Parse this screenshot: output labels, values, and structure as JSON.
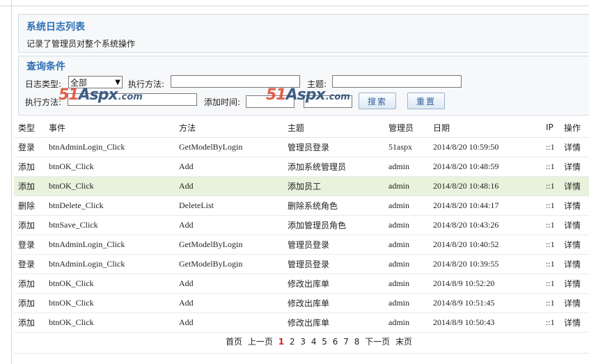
{
  "header": {
    "title": "系统日志列表",
    "description": "记录了管理员对整个系统操作"
  },
  "query": {
    "title": "查询条件",
    "log_type_label": "日志类型:",
    "log_type_value": "全部",
    "method_label_1": "执行方法:",
    "subject_label": "主题:",
    "method_label_2": "执行方法:",
    "add_time_label": "添加时间:",
    "search_label": "搜索",
    "reset_label": "重置"
  },
  "watermark": {
    "num": "51",
    "name": "Aspx",
    "suffix": ".com"
  },
  "table": {
    "headers": [
      "类型",
      "事件",
      "方法",
      "主题",
      "管理员",
      "日期",
      "IP",
      "操作"
    ],
    "rows": [
      [
        "登录",
        "btnAdminLogin_Click",
        "GetModelByLogin",
        "管理员登录",
        "51aspx",
        "2014/8/20 10:59:50",
        "::1",
        "详情"
      ],
      [
        "添加",
        "btnOK_Click",
        "Add",
        "添加系统管理员",
        "admin",
        "2014/8/20 10:48:59",
        "::1",
        "详情"
      ],
      [
        "添加",
        "btnOK_Click",
        "Add",
        "添加员工",
        "admin",
        "2014/8/20 10:48:16",
        "::1",
        "详情"
      ],
      [
        "删除",
        "btnDelete_Click",
        "DeleteList",
        "删除系统角色",
        "admin",
        "2014/8/20 10:44:17",
        "::1",
        "详情"
      ],
      [
        "添加",
        "btnSave_Click",
        "Add",
        "添加管理员角色",
        "admin",
        "2014/8/20 10:43:26",
        "::1",
        "详情"
      ],
      [
        "登录",
        "btnAdminLogin_Click",
        "GetModelByLogin",
        "管理员登录",
        "admin",
        "2014/8/20 10:40:52",
        "::1",
        "详情"
      ],
      [
        "登录",
        "btnAdminLogin_Click",
        "GetModelByLogin",
        "管理员登录",
        "admin",
        "2014/8/20 10:39:55",
        "::1",
        "详情"
      ],
      [
        "添加",
        "btnOK_Click",
        "Add",
        "修改出库单",
        "admin",
        "2014/8/9 10:52:20",
        "::1",
        "详情"
      ],
      [
        "添加",
        "btnOK_Click",
        "Add",
        "修改出库单",
        "admin",
        "2014/8/9 10:51:45",
        "::1",
        "详情"
      ],
      [
        "添加",
        "btnOK_Click",
        "Add",
        "修改出库单",
        "admin",
        "2014/8/9 10:50:43",
        "::1",
        "详情"
      ]
    ]
  },
  "pager": {
    "first": "首页",
    "prev": "上一页",
    "pages": [
      "1",
      "2",
      "3",
      "4",
      "5",
      "6",
      "7",
      "8"
    ],
    "current": "1",
    "next": "下一页",
    "last": "末页"
  },
  "colors": {
    "accent": "#2f6fb6",
    "highlight_row": "#e9f2dc",
    "current_page": "#c8281e"
  }
}
